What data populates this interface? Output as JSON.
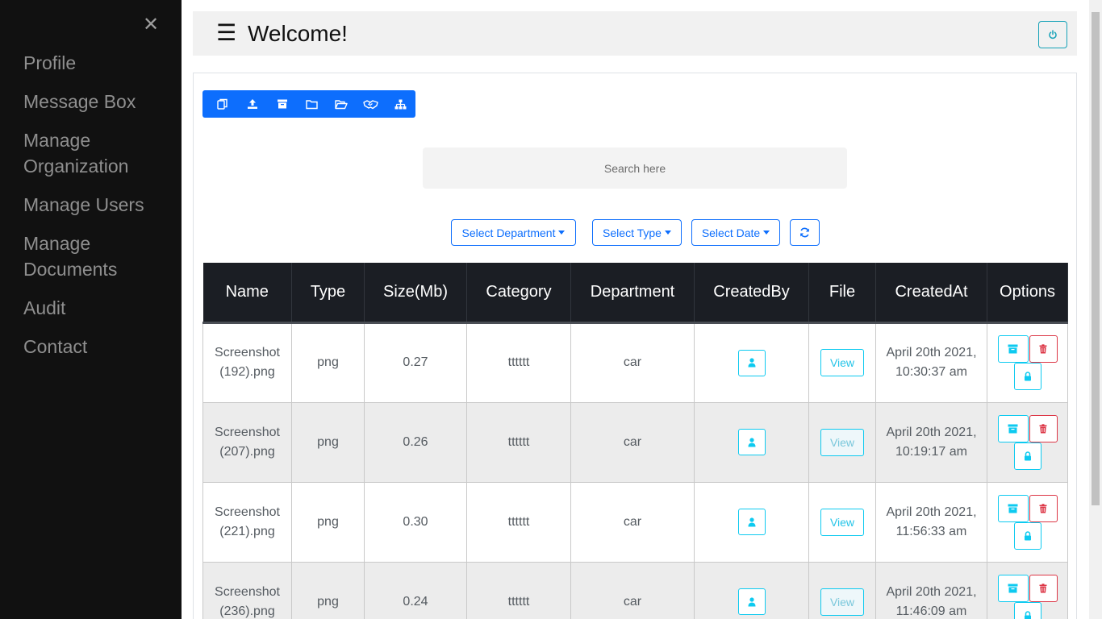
{
  "sidebar": {
    "close_glyph": "✕",
    "items": [
      {
        "label": "Profile"
      },
      {
        "label": "Message Box"
      },
      {
        "label": "Manage Organization"
      },
      {
        "label": "Manage Users"
      },
      {
        "label": "Manage Documents"
      },
      {
        "label": "Audit"
      },
      {
        "label": "Contact"
      }
    ]
  },
  "header": {
    "menu_glyph": "☰",
    "title": "Welcome!",
    "power_icon": "power-icon"
  },
  "toolbar": {
    "icons": [
      "copy-icon",
      "upload-icon",
      "archive-icon",
      "folder-icon",
      "folder-open-icon",
      "handshake-icon",
      "sitemap-icon"
    ]
  },
  "search": {
    "placeholder": "Search here"
  },
  "filters": {
    "department": "Select Department",
    "type": "Select Type",
    "date": "Select Date",
    "refresh_icon": "refresh-icon"
  },
  "table": {
    "headers": [
      "Name",
      "Type",
      "Size(Mb)",
      "Category",
      "Department",
      "CreatedBy",
      "File",
      "CreatedAt",
      "Options"
    ],
    "view_label": "View",
    "rows": [
      {
        "name": "Screenshot (192).png",
        "type": "png",
        "size": "0.27",
        "category": "tttttt",
        "department": "car",
        "created_at": "April 20th 2021, 10:30:37 am"
      },
      {
        "name": "Screenshot (207).png",
        "type": "png",
        "size": "0.26",
        "category": "tttttt",
        "department": "car",
        "created_at": "April 20th 2021, 10:19:17 am"
      },
      {
        "name": "Screenshot (221).png",
        "type": "png",
        "size": "0.30",
        "category": "tttttt",
        "department": "car",
        "created_at": "April 20th 2021, 11:56:33 am"
      },
      {
        "name": "Screenshot (236).png",
        "type": "png",
        "size": "0.24",
        "category": "tttttt",
        "department": "car",
        "created_at": "April 20th 2021, 11:46:09 am"
      }
    ]
  },
  "colors": {
    "sidebar_bg": "#111111",
    "primary": "#0d6efd",
    "info": "#0dcaf0",
    "danger": "#dc3545",
    "table_header_bg": "#1b1e24"
  }
}
